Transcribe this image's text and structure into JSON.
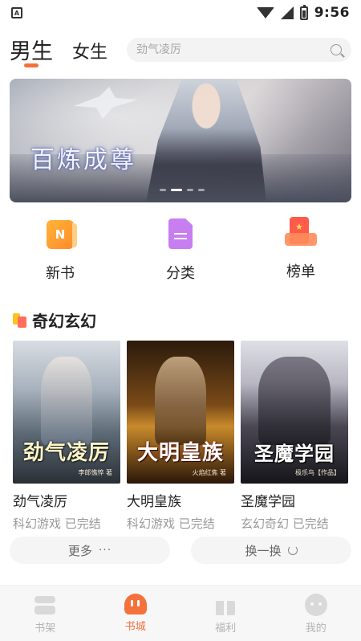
{
  "status_bar": {
    "time": "9:56",
    "icons": [
      "app-notification-icon",
      "wifi-icon",
      "signal-icon",
      "battery-icon"
    ]
  },
  "header": {
    "tabs": [
      "男生",
      "女生"
    ],
    "active_tab": "男生",
    "search_placeholder": "劲气凌厉",
    "accent_color": "#f5713b"
  },
  "banner": {
    "title": "百炼成尊",
    "dots": 4,
    "active_dot": 1
  },
  "quick_nav": [
    {
      "label": "新书",
      "icon": "new-book-icon",
      "badge": "N"
    },
    {
      "label": "分类",
      "icon": "category-icon"
    },
    {
      "label": "榜单",
      "icon": "ranking-icon"
    }
  ],
  "section": {
    "title": "奇幻玄幻",
    "icon": "section-book-icon",
    "books": [
      {
        "title": "劲气凌厉",
        "cover_title": "劲气凌厉",
        "cover_author": "李郎憔悴 著",
        "meta": "科幻游戏 已完结"
      },
      {
        "title": "大明皇族",
        "cover_title": "大明皇族",
        "cover_author": "火焰红焦 著",
        "meta": "科幻游戏 已完结"
      },
      {
        "title": "圣魔学园",
        "cover_title": "圣魔学园",
        "cover_author": "极乐鸟【作品】",
        "meta": "玄幻奇幻 已完结"
      }
    ],
    "more_label": "更多",
    "more_icon": "···",
    "refresh_label": "换一换"
  },
  "bottom_nav": [
    {
      "label": "书架",
      "icon": "bookshelf-icon"
    },
    {
      "label": "书城",
      "icon": "bookstore-icon",
      "active": true
    },
    {
      "label": "福利",
      "icon": "gift-icon"
    },
    {
      "label": "我的",
      "icon": "profile-icon"
    }
  ]
}
